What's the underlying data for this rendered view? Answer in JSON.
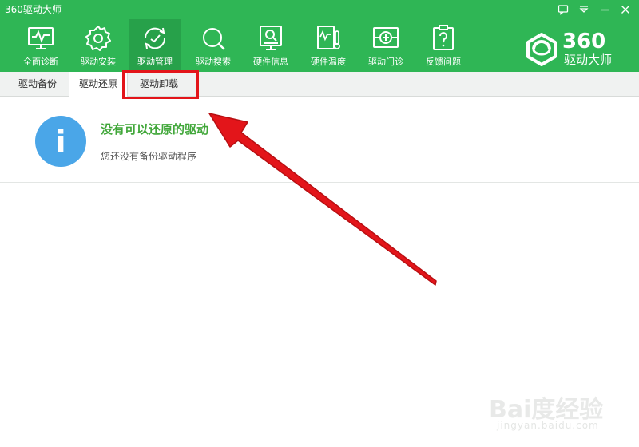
{
  "window": {
    "title": "360驱动大师"
  },
  "toolbar": {
    "items": [
      {
        "label": "全面诊断",
        "icon": "monitor-pulse-icon"
      },
      {
        "label": "驱动安装",
        "icon": "gear-icon"
      },
      {
        "label": "驱动管理",
        "icon": "refresh-icon"
      },
      {
        "label": "驱动搜索",
        "icon": "search-icon"
      },
      {
        "label": "硬件信息",
        "icon": "monitor-search-icon"
      },
      {
        "label": "硬件温度",
        "icon": "thermometer-icon"
      },
      {
        "label": "驱动门诊",
        "icon": "clinic-icon"
      },
      {
        "label": "反馈问题",
        "icon": "question-icon"
      }
    ],
    "active_index": 2
  },
  "brand": {
    "number": "360",
    "name": "驱动大师"
  },
  "subtabs": {
    "items": [
      {
        "label": "驱动备份"
      },
      {
        "label": "驱动还原"
      },
      {
        "label": "驱动卸载"
      }
    ],
    "active_index": 1
  },
  "info": {
    "title": "没有可以还原的驱动",
    "description": "您还没有备份驱动程序",
    "icon_glyph": "i"
  },
  "watermark": {
    "logo": "Bai度经验",
    "url": "jingyan.baidu.com"
  },
  "colors": {
    "brand_green": "#2fb655",
    "active_green": "#27a14a",
    "info_blue": "#4aa6e8",
    "title_green": "#41a73a",
    "highlight_red": "#e3151a"
  }
}
